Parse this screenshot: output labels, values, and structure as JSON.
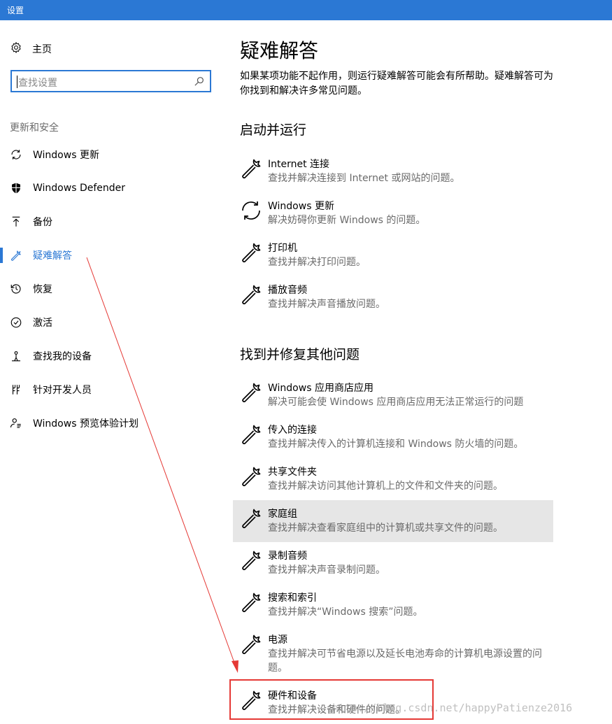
{
  "window": {
    "title": "设置"
  },
  "sidebar": {
    "home_label": "主页",
    "search_placeholder": "查找设置",
    "section_title": "更新和安全",
    "items": [
      {
        "label": "Windows 更新",
        "icon": "sync-icon"
      },
      {
        "label": "Windows Defender",
        "icon": "shield-icon"
      },
      {
        "label": "备份",
        "icon": "upload-arrow-icon"
      },
      {
        "label": "疑难解答",
        "icon": "wrench-icon",
        "active": true
      },
      {
        "label": "恢复",
        "icon": "history-icon"
      },
      {
        "label": "激活",
        "icon": "check-circle-icon"
      },
      {
        "label": "查找我的设备",
        "icon": "person-location-icon"
      },
      {
        "label": "针对开发人员",
        "icon": "developer-tools-icon"
      },
      {
        "label": "Windows 预览体验计划",
        "icon": "person-insider-icon"
      }
    ]
  },
  "main": {
    "title": "疑难解答",
    "description": "如果某项功能不起作用，则运行疑难解答可能会有所帮助。疑难解答可为你找到和解决许多常见问题。",
    "section1_title": "启动并运行",
    "section1_items": [
      {
        "name": "Internet 连接",
        "desc": "查找并解决连接到 Internet 或网站的问题。",
        "icon": "wrench-icon"
      },
      {
        "name": "Windows 更新",
        "desc": "解决妨碍你更新 Windows 的问题。",
        "icon": "sync-icon"
      },
      {
        "name": "打印机",
        "desc": "查找并解决打印问题。",
        "icon": "wrench-icon"
      },
      {
        "name": "播放音频",
        "desc": "查找并解决声音播放问题。",
        "icon": "wrench-icon"
      }
    ],
    "section2_title": "找到并修复其他问题",
    "section2_items": [
      {
        "name": "Windows 应用商店应用",
        "desc": "解决可能会使 Windows 应用商店应用无法正常运行的问题",
        "icon": "wrench-icon"
      },
      {
        "name": "传入的连接",
        "desc": "查找并解决传入的计算机连接和 Windows 防火墙的问题。",
        "icon": "wrench-icon"
      },
      {
        "name": "共享文件夹",
        "desc": "查找并解决访问其他计算机上的文件和文件夹的问题。",
        "icon": "wrench-icon"
      },
      {
        "name": "家庭组",
        "desc": "查找并解决查看家庭组中的计算机或共享文件的问题。",
        "icon": "wrench-icon",
        "hover": true
      },
      {
        "name": "录制音频",
        "desc": "查找并解决声音录制问题。",
        "icon": "wrench-icon"
      },
      {
        "name": "搜索和索引",
        "desc": "查找并解决“Windows 搜索”问题。",
        "icon": "wrench-icon"
      },
      {
        "name": "电源",
        "desc": "查找并解决可节省电源以及延长电池寿命的计算机电源设置的问题。",
        "icon": "wrench-icon"
      },
      {
        "name": "硬件和设备",
        "desc": "查找并解决设备和硬件的问题。",
        "icon": "wrench-icon"
      }
    ]
  },
  "annotation": {
    "watermark": "http://blog.csdn.net/happyPatienze2016",
    "arrow_color": "#e53935",
    "box_color": "#e53935"
  },
  "colors": {
    "accent": "#2b78d4",
    "hover_bg": "#e6e6e6",
    "secondary_text": "#6a6a6a"
  }
}
